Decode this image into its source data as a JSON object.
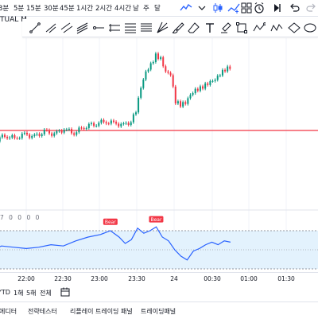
{
  "toolbar": {
    "timeframes": [
      "3분",
      "5분",
      "15분",
      "30분",
      "45분",
      "1시간",
      "2시간",
      "4시간",
      "날",
      "주",
      "달"
    ],
    "icons": [
      "line-chart-icon",
      "candles-icon",
      "indicators-icon",
      "templates-icon",
      "alert-clock-icon",
      "replay-icon",
      "undo-icon",
      "redo-icon"
    ]
  },
  "symbol": {
    "label": "TUAL M"
  },
  "drawing_tools": [
    "trend-line-icon",
    "ray-icon",
    "parallel-channel-icon",
    "pitchfork-icon",
    "horizontal-ray-icon",
    "regression-icon",
    "fib-retracement-icon",
    "fib-channel-icon",
    "gann-fan-icon",
    "brush-icon",
    "eraser-icon",
    "text-icon",
    "highlighter-icon",
    "rectangle-icon",
    "path-icon",
    "zigzag-icon",
    "ellipse-icon"
  ],
  "indicator": {
    "legend": "7 0 0 0 0",
    "markers": [
      {
        "label": "Bear",
        "time": "23:08",
        "value": 62
      },
      {
        "label": "Bear",
        "time": "23:45",
        "value": 64
      }
    ],
    "fill_color": "#e3f2fd",
    "line_color": "#2962ff",
    "marker_color": "#f23645"
  },
  "chart_data": {
    "type": "candlestick",
    "up_color": "#089981",
    "down_color": "#f23645",
    "resistance_color": "#f23645",
    "resistance_label": "",
    "x_ticks": [
      "22:00",
      "22:30",
      "23:00",
      "23:30",
      "24",
      "00:30",
      "01:00",
      "01:30"
    ],
    "price_series": [
      [
        "21:20",
        18
      ],
      [
        "21:28",
        20
      ],
      [
        "21:36",
        17
      ],
      [
        "21:44",
        21
      ],
      [
        "21:52",
        19
      ],
      [
        "22:00",
        22
      ],
      [
        "22:08",
        20
      ],
      [
        "22:16",
        24
      ],
      [
        "22:24",
        22
      ],
      [
        "22:32",
        26
      ],
      [
        "22:40",
        23
      ],
      [
        "22:48",
        28
      ],
      [
        "22:56",
        30
      ],
      [
        "23:04",
        32
      ],
      [
        "23:12",
        31
      ],
      [
        "23:20",
        29
      ],
      [
        "23:26",
        32
      ],
      [
        "23:30",
        40
      ],
      [
        "23:34",
        58
      ],
      [
        "23:38",
        70
      ],
      [
        "23:42",
        76
      ],
      [
        "23:46",
        84
      ],
      [
        "23:50",
        82
      ],
      [
        "23:54",
        72
      ],
      [
        "23:58",
        70
      ],
      [
        "24:02",
        48
      ],
      [
        "24:06",
        45
      ],
      [
        "24:10",
        46
      ],
      [
        "24:14",
        52
      ],
      [
        "24:18",
        56
      ],
      [
        "24:22",
        58
      ],
      [
        "24:26",
        61
      ],
      [
        "24:30",
        64
      ],
      [
        "24:34",
        66
      ],
      [
        "24:38",
        70
      ],
      [
        "24:42",
        73
      ],
      [
        "24:46",
        74
      ]
    ],
    "indicator_series": [
      [
        "21:20",
        45
      ],
      [
        "21:30",
        44
      ],
      [
        "21:40",
        48
      ],
      [
        "21:50",
        47
      ],
      [
        "22:00",
        46
      ],
      [
        "22:10",
        47
      ],
      [
        "22:20",
        49
      ],
      [
        "22:30",
        48
      ],
      [
        "22:40",
        52
      ],
      [
        "22:50",
        55
      ],
      [
        "23:00",
        57
      ],
      [
        "23:08",
        60
      ],
      [
        "23:15",
        55
      ],
      [
        "23:20",
        50
      ],
      [
        "23:25",
        53
      ],
      [
        "23:30",
        62
      ],
      [
        "23:35",
        58
      ],
      [
        "23:40",
        60
      ],
      [
        "23:45",
        63
      ],
      [
        "23:50",
        55
      ],
      [
        "23:55",
        52
      ],
      [
        "24:00",
        45
      ],
      [
        "24:05",
        40
      ],
      [
        "24:10",
        37
      ],
      [
        "24:15",
        44
      ],
      [
        "24:20",
        46
      ],
      [
        "24:25",
        49
      ],
      [
        "24:30",
        51
      ],
      [
        "24:35",
        49
      ],
      [
        "24:40",
        52
      ],
      [
        "24:45",
        51
      ]
    ]
  },
  "time_axis": {
    "ticks": [
      "22:00",
      "22:30",
      "23:00",
      "23:30",
      "24",
      "00:30",
      "01:00",
      "01:30"
    ]
  },
  "range_bar": {
    "items": [
      "YTD",
      "1해",
      "5해",
      "전체"
    ],
    "calendar_icon": "calendar-range-icon"
  },
  "bottom_bar": {
    "tabs": [
      "에디터",
      "전략테스터",
      "리플레이 트레이딩 패널",
      "트레이딩패널"
    ]
  }
}
